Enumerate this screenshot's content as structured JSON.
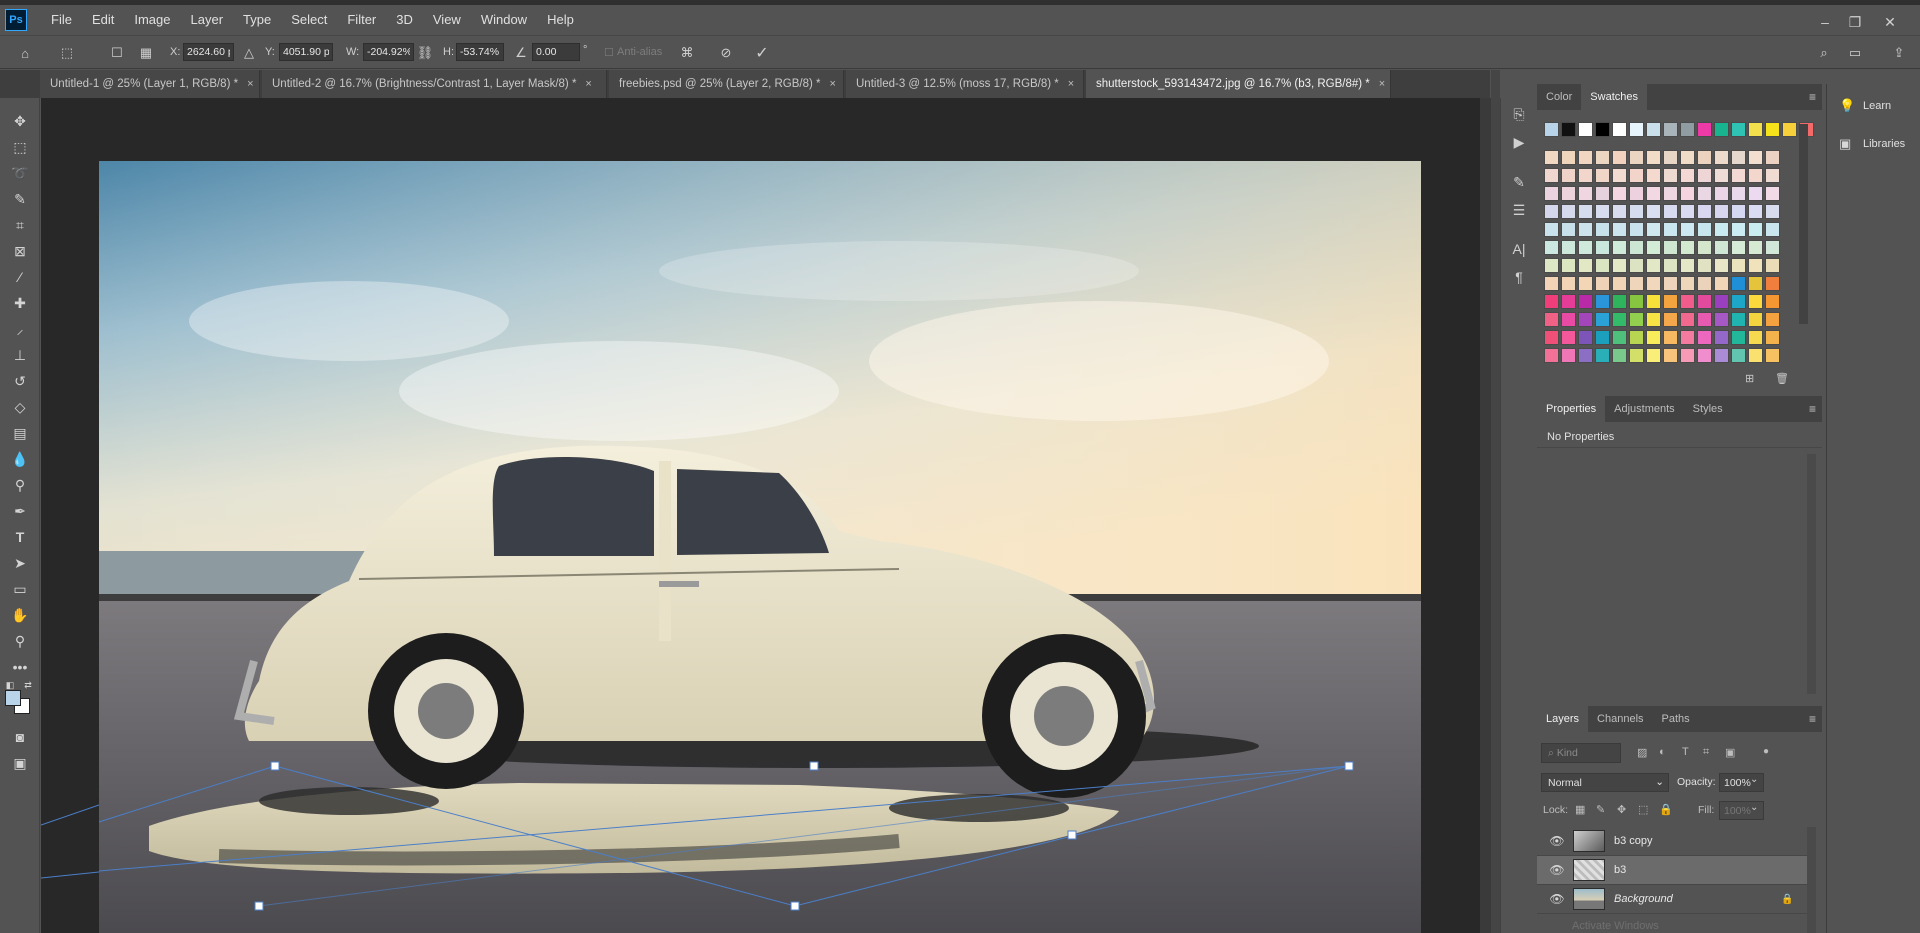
{
  "app": {
    "logo": "Ps"
  },
  "menu": [
    "File",
    "Edit",
    "Image",
    "Layer",
    "Type",
    "Select",
    "Filter",
    "3D",
    "View",
    "Window",
    "Help"
  ],
  "window_controls": {
    "minimize": "–",
    "restore": "❐",
    "close": "✕"
  },
  "options_bar": {
    "x_label": "X:",
    "x_value": "2624.60 p",
    "y_label": "Y:",
    "y_value": "4051.90 p",
    "w_label": "W:",
    "w_value": "-204.92%",
    "h_label": "H:",
    "h_value": "-53.74%",
    "angle_value": "0.00",
    "degree_symbol": "°",
    "antialias_label": "Anti-alias"
  },
  "tabs": [
    {
      "label": "Untitled-1 @ 25% (Layer 1, RGB/8) *"
    },
    {
      "label": "Untitled-2 @ 16.7% (Brightness/Contrast 1, Layer Mask/8) *"
    },
    {
      "label": "freebies.psd @ 25% (Layer 2, RGB/8) *"
    },
    {
      "label": "Untitled-3 @ 12.5% (moss 17, RGB/8) *"
    },
    {
      "label": "shutterstock_593143472.jpg @ 16.7% (b3, RGB/8#) *"
    }
  ],
  "tab_close": "×",
  "color_panel": {
    "tabs": [
      "Color",
      "Swatches"
    ],
    "active": "Swatches",
    "top_swatches": [
      "#b9d3e8",
      "#111111",
      "#ffffff",
      "#000000",
      "#ffffff",
      "#e8f4fb",
      "#c9dfe9",
      "#a8b4ba",
      "#8f9ca2",
      "#ee3aa6",
      "#18b48f",
      "#2ec3b3",
      "#f4e04d",
      "#f6e21b",
      "#f6cf3b",
      "#f46a6a"
    ],
    "pastel_rows": [
      [
        "#f0d8c3",
        "#f0d5bd",
        "#f1d6c2",
        "#ebd6c1",
        "#f1d2be",
        "#ead5c3",
        "#f0dcc7",
        "#e7d5c6",
        "#f0dac8",
        "#ebd3c0",
        "#eedacb",
        "#e6d8cc",
        "#f2dfcf",
        "#ecd2c2"
      ],
      [
        "#efd7d0",
        "#f0d3c8",
        "#f3d6cb",
        "#efd6c6",
        "#f2dcd1",
        "#f2d4cb",
        "#f4d9ce",
        "#efdad1",
        "#f3d8d4",
        "#efd6d6",
        "#f0dcd6",
        "#f3d9d3",
        "#f3d6cc",
        "#f0dbd3"
      ],
      [
        "#ecd3e0",
        "#edd3dc",
        "#f0d6e1",
        "#e6d2dc",
        "#f2d6e2",
        "#edd1de",
        "#f1d8e2",
        "#ecd6e2",
        "#f4d5df",
        "#ead7e4",
        "#e9d5e6",
        "#e9d9ea",
        "#ecdaf0",
        "#f2dbe6"
      ],
      [
        "#d4d6ec",
        "#d6d9eb",
        "#d6ddef",
        "#d8dcef",
        "#d9dced",
        "#d6ddef",
        "#dadef0",
        "#d8dbef",
        "#dadaf0",
        "#d9d6ef",
        "#d8d5ef",
        "#d6d7f1",
        "#d9dcf2",
        "#d7dbee"
      ],
      [
        "#c9e2ec",
        "#c8e0ea",
        "#cce3ec",
        "#c7e1ea",
        "#cbe4ed",
        "#cae2ec",
        "#cfe7ee",
        "#cae6ee",
        "#cde8f0",
        "#c8e6ee",
        "#caeaf1",
        "#cbebf2",
        "#c9ecf0",
        "#c9e6ee"
      ],
      [
        "#cbe7df",
        "#cde7da",
        "#cfe9dd",
        "#c9e7dc",
        "#d0ead9",
        "#cde6d3",
        "#d3ecd6",
        "#cfe7d1",
        "#d3ead1",
        "#d4e7cd",
        "#cfe6d5",
        "#d6ecd7",
        "#d5e9d3",
        "#d1e8d8"
      ],
      [
        "#dde7c5",
        "#dce7c1",
        "#e1e8c3",
        "#dae6c2",
        "#e3e9c7",
        "#dbe3c2",
        "#e2e7c6",
        "#dce4c4",
        "#e5e8c6",
        "#e1e2c3",
        "#e8e6c6",
        "#ebe3be",
        "#f0e2bb",
        "#eadcb7"
      ],
      [
        "#f2d3b5",
        "#f1d3b6",
        "#f2d6b6",
        "#efd3b8",
        "#f1d4b5",
        "#efd5ba",
        "#f1d7bb",
        "#edd4bb",
        "#eed6bb",
        "#ebd2ba",
        "#f1d5b9",
        "#1f8fd8",
        "#e3c43a",
        "#f07f3e"
      ]
    ],
    "bright_rows": [
      [
        "#ef3e7a",
        "#e53c98",
        "#b82aa8",
        "#2a95d8",
        "#2fb35d",
        "#87c540",
        "#f5e13a",
        "#f4a43f",
        "#f05d8d",
        "#e24a9e",
        "#9a3fbd",
        "#1ea6c8",
        "#f9d93c",
        "#f49733"
      ],
      [
        "#f06186",
        "#e84aa4",
        "#a346b9",
        "#2aa2d5",
        "#34bb6a",
        "#93cf4f",
        "#f7e344",
        "#f5a84b",
        "#f2698f",
        "#e65ab0",
        "#a658c5",
        "#20b3b0",
        "#f3d43f",
        "#f3a23f"
      ],
      [
        "#ee5077",
        "#f2589a",
        "#7d54b8",
        "#1aa0bc",
        "#4ec07b",
        "#b8d551",
        "#f8ec5b",
        "#f6b861",
        "#f37ba0",
        "#ec67be",
        "#9468c8",
        "#22b79a",
        "#f6d94e",
        "#f3b24b"
      ],
      [
        "#f27196",
        "#ef77b6",
        "#8a6fc4",
        "#2aaeb8",
        "#79c98c",
        "#d2e06a",
        "#f9ee77",
        "#f8c37b",
        "#f69ab5",
        "#f08dcc",
        "#aa8bd6",
        "#61c5b0",
        "#fae06f",
        "#f6c160"
      ]
    ]
  },
  "properties_panel": {
    "tabs": [
      "Properties",
      "Adjustments",
      "Styles"
    ],
    "active": "Properties",
    "empty_text": "No Properties"
  },
  "layers_panel": {
    "tabs": [
      "Layers",
      "Channels",
      "Paths"
    ],
    "active": "Layers",
    "kind_placeholder": "Kind",
    "blend_mode": "Normal",
    "opacity_label": "Opacity:",
    "opacity_value": "100%",
    "lock_label": "Lock:",
    "fill_label": "Fill:",
    "fill_value": "100%",
    "layers": [
      {
        "name": "b3 copy",
        "selected": false,
        "italic": false
      },
      {
        "name": "b3",
        "selected": true,
        "italic": false
      },
      {
        "name": "Background",
        "selected": false,
        "italic": true
      }
    ],
    "faint_text": "Activate Windows"
  },
  "learn_column": {
    "learn": "Learn",
    "libraries": "Libraries"
  },
  "colors": {
    "ui_bg": "#535353",
    "canvas_bg": "#282828",
    "transform_line": "#4b7fc9"
  }
}
